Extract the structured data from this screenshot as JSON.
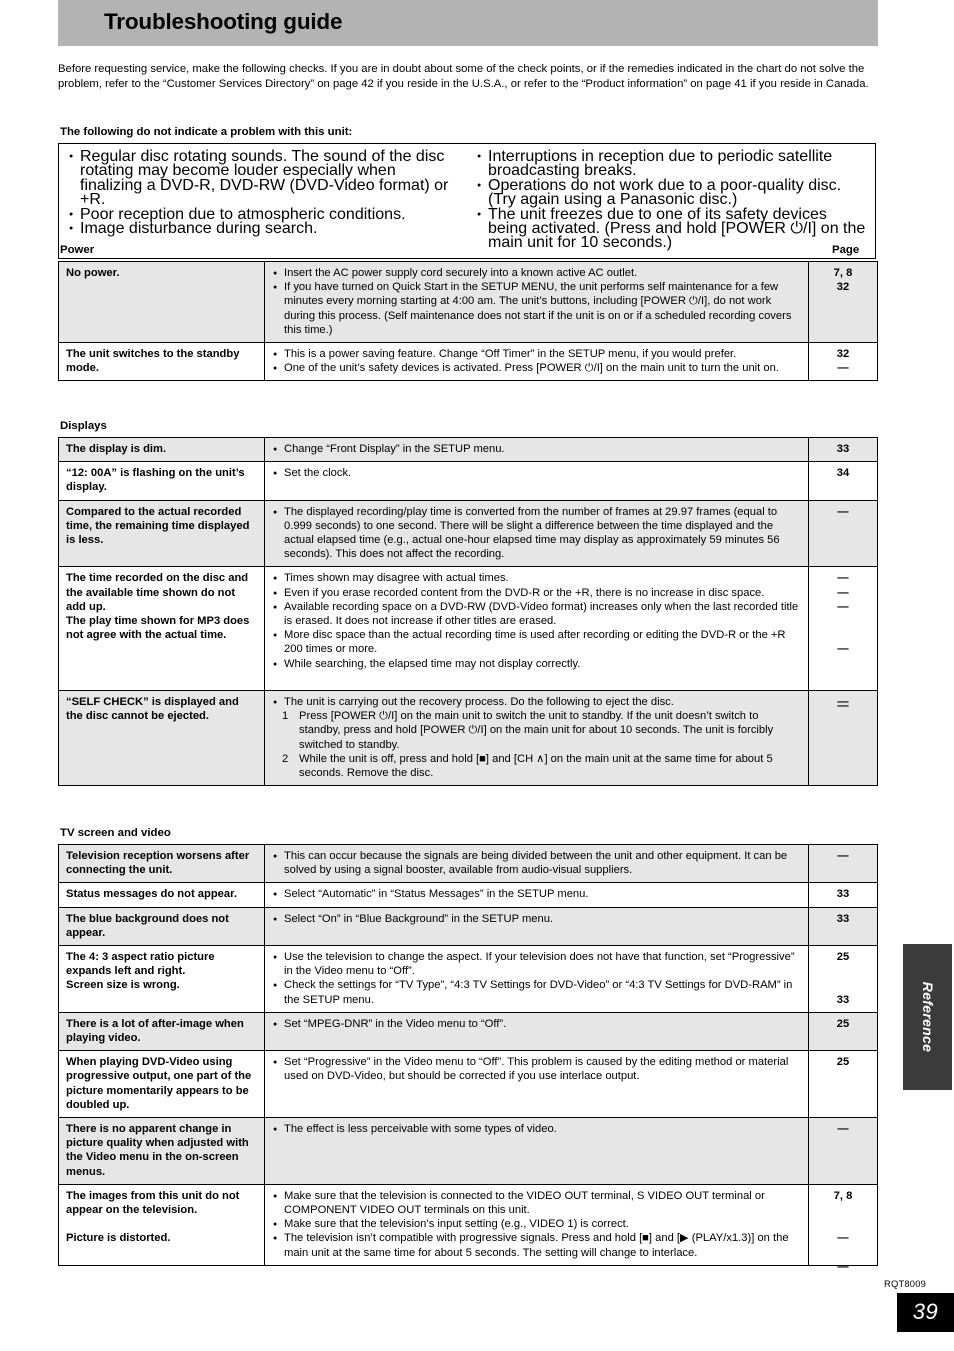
{
  "header": {
    "title": "Troubleshooting guide"
  },
  "intro": "Before requesting service, make the following checks. If you are in doubt about some of the check points, or if the remedies indicated in the chart do not solve the problem, refer to the “Customer Services Directory” on page 42 if you reside in the U.S.A., or refer to the “Product information” on page 41 if you reside in Canada.",
  "no_problem": {
    "heading": "The following do not indicate a problem with this unit:",
    "left": [
      "Regular disc rotating sounds. The sound of the disc rotating may become louder especially when finalizing a DVD-R, DVD-RW (DVD-Video format) or +R.",
      "Poor reception due to atmospheric conditions.",
      "Image disturbance during search."
    ],
    "right": [
      "Interruptions in reception due to periodic satellite broadcasting breaks.",
      "Operations do not work due to a poor-quality disc. (Try again using a Panasonic disc.)",
      "The unit freezes due to one of its safety devices being activated. (Press and hold [POWER ⏻/I] on the main unit for 10 seconds.)"
    ]
  },
  "sections": [
    {
      "name": "Power",
      "page_label": "Page",
      "rows": [
        {
          "symptom": "No power.",
          "remedies": [
            "Insert the AC power supply cord securely into a known active AC outlet.",
            "If you have turned on Quick Start in the SETUP MENU, the unit performs self maintenance for a few minutes every morning starting at 4:00 am. The unit’s buttons, including [POWER ⏻/I], do not work during this process. (Self maintenance does not start if the unit is on or if a scheduled recording covers this time.)"
          ],
          "pages": [
            "7, 8",
            "32"
          ]
        },
        {
          "symptom": "The unit switches to the standby mode.",
          "remedies": [
            "This is a power saving feature. Change “Off Timer” in the SETUP menu, if you would prefer.",
            "One of the unit’s safety devices is activated. Press [POWER ⏻/I] on the main unit to turn the unit on."
          ],
          "pages": [
            "32",
            "—"
          ]
        }
      ]
    },
    {
      "name": "Displays",
      "page_label": "",
      "rows": [
        {
          "symptom": "The display is dim.",
          "remedies": [
            "Change “Front Display” in the SETUP menu."
          ],
          "pages": [
            "33"
          ]
        },
        {
          "symptom": "“12: 00A” is flashing on the unit’s display.",
          "remedies": [
            "Set the clock."
          ],
          "pages": [
            "34"
          ]
        },
        {
          "symptom": "Compared to the actual recorded time, the remaining time displayed is less.",
          "remedies": [
            "The displayed recording/play time is converted from the number of frames at 29.97 frames (equal to 0.999 seconds) to one second. There will be slight a difference between the time displayed and the actual elapsed time (e.g., actual one-hour elapsed time may display as approximately 59 minutes 56 seconds). This does not affect the recording."
          ],
          "pages": [
            "—"
          ]
        },
        {
          "symptom": "The time recorded on the disc and the available time shown do not add up.\nThe play time shown for MP3 does not agree with the actual time.",
          "remedies": [
            "Times shown may disagree with actual times.",
            "Even if you erase recorded content from the DVD-R or the +R, there is no increase in disc space.",
            "Available recording space on a DVD-RW (DVD-Video format) increases only when the last recorded title is erased. It does not increase if other titles are erased.",
            "More disc space than the actual recording time is used after recording or editing the DVD-R or the +R 200 times or more.",
            "While searching, the elapsed time may not display correctly."
          ],
          "pages": [
            "—",
            "—",
            "—",
            "—",
            "—"
          ]
        },
        {
          "symptom": "“SELF CHECK” is displayed and the disc cannot be ejected.",
          "remedies": [
            "The unit is carrying out the recovery process. Do the following to eject the disc."
          ],
          "steps": [
            "Press [POWER ⏻/I] on the main unit to switch the unit to standby. If the unit doesn’t switch to standby, press and hold [POWER ⏻/I] on the main unit for about 10 seconds. The unit is forcibly switched to standby.",
            "While the unit is off, press and hold [■] and [CH ∧] on the main unit at the same time for about 5 seconds. Remove the disc."
          ],
          "pages": [
            "—"
          ]
        }
      ]
    },
    {
      "name": "TV screen and video",
      "page_label": "",
      "rows": [
        {
          "symptom": "Television reception worsens after connecting the unit.",
          "remedies": [
            "This can occur because the signals are being divided between the unit and other equipment. It can be solved by using a signal booster, available from audio-visual suppliers."
          ],
          "pages": [
            "—"
          ]
        },
        {
          "symptom": "Status messages do not appear.",
          "remedies": [
            "Select “Automatic” in “Status Messages” in the SETUP menu."
          ],
          "pages": [
            "33"
          ]
        },
        {
          "symptom": "The blue background does not appear.",
          "remedies": [
            "Select “On” in “Blue Background” in the SETUP menu."
          ],
          "pages": [
            "33"
          ]
        },
        {
          "symptom": "The 4: 3 aspect ratio picture expands left and right.\nScreen size is wrong.",
          "remedies": [
            "Use the television to change the aspect. If your television does not have that function, set “Progressive” in the Video menu to “Off”.",
            "Check the settings for “TV Type”, “4:3 TV Settings for DVD-Video” or “4:3 TV Settings for DVD-RAM” in the SETUP menu."
          ],
          "pages": [
            "25",
            "33"
          ]
        },
        {
          "symptom": "There is a lot of after-image when playing video.",
          "remedies": [
            "Set “MPEG-DNR” in the Video menu to “Off”."
          ],
          "pages": [
            "25"
          ]
        },
        {
          "symptom": "When playing DVD-Video using progressive output, one part of the picture momentarily appears to be doubled up.",
          "remedies": [
            "Set “Progressive” in the Video menu to “Off”. This problem is caused by the editing method or material used on DVD-Video, but should be corrected if you use interlace output."
          ],
          "pages": [
            "25"
          ]
        },
        {
          "symptom": "There is no apparent change in picture quality when adjusted with the Video menu in the on-screen menus.",
          "remedies": [
            "The effect is less perceivable with some types of video."
          ],
          "pages": [
            "—"
          ]
        },
        {
          "symptom": "The images from this unit do not appear on the television.\n\nPicture is distorted.",
          "remedies": [
            "Make sure that the television is connected to the VIDEO OUT terminal, S VIDEO OUT terminal or COMPONENT VIDEO OUT terminals on this unit.",
            "Make sure that the television’s input setting (e.g., VIDEO 1) is correct.",
            "The television isn’t compatible with progressive signals. Press and hold [■] and [▶ (PLAY/x1.3)] on the main unit at the same time for about 5 seconds. The setting will change to interlace."
          ],
          "pages": [
            "7, 8",
            "—",
            "—"
          ]
        }
      ]
    }
  ],
  "side_tab": {
    "label": "Reference"
  },
  "footer": {
    "doc_code": "RQT8009",
    "page_number": "39"
  }
}
